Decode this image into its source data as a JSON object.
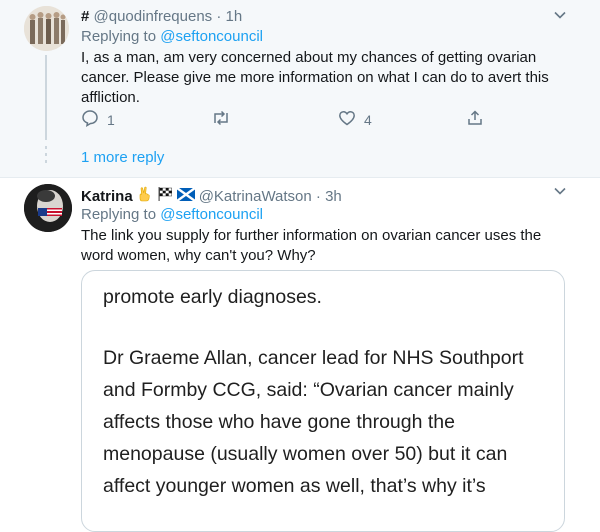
{
  "tweet1": {
    "display_name": "#",
    "handle_time": "@quodinfrequens · 1h",
    "replying_prefix": "Replying to",
    "replying_handle": "@seftoncouncil",
    "text_lines": [
      "I, as a man, am very concerned about my chances of getting ovarian",
      "cancer. Please give me more information on what I can do to avert this",
      "affliction."
    ],
    "reply_count": "1",
    "like_count": "4",
    "more_reply_label": "1 more reply"
  },
  "tweet2": {
    "display_name": "Katrina",
    "handle_time": "@KatrinaWatson · 3h",
    "replying_prefix": "Replying to",
    "replying_handle": "@seftoncouncil",
    "text_lines": [
      "The link you supply for further information on ovarian cancer uses the",
      "word women, why can't you? Why?"
    ],
    "card_lines": [
      "promote early diagnoses.",
      "",
      "Dr Graeme Allan, cancer lead for NHS Southport",
      "and Formby CCG, said: “Ovarian cancer mainly",
      "affects those who have gone through the",
      "menopause (usually women over 50) but it can",
      "affect younger women as well, that’s why it’s"
    ]
  },
  "colors": {
    "link": "#1da1f2",
    "muted": "#657786",
    "hover_bg": "#f5f8fa"
  },
  "icons": [
    "reply-icon",
    "retweet-icon",
    "like-icon",
    "share-icon",
    "chevron-down-icon",
    "victory-hand-emoji",
    "checkered-flag-emoji",
    "scotland-flag-emoji"
  ]
}
